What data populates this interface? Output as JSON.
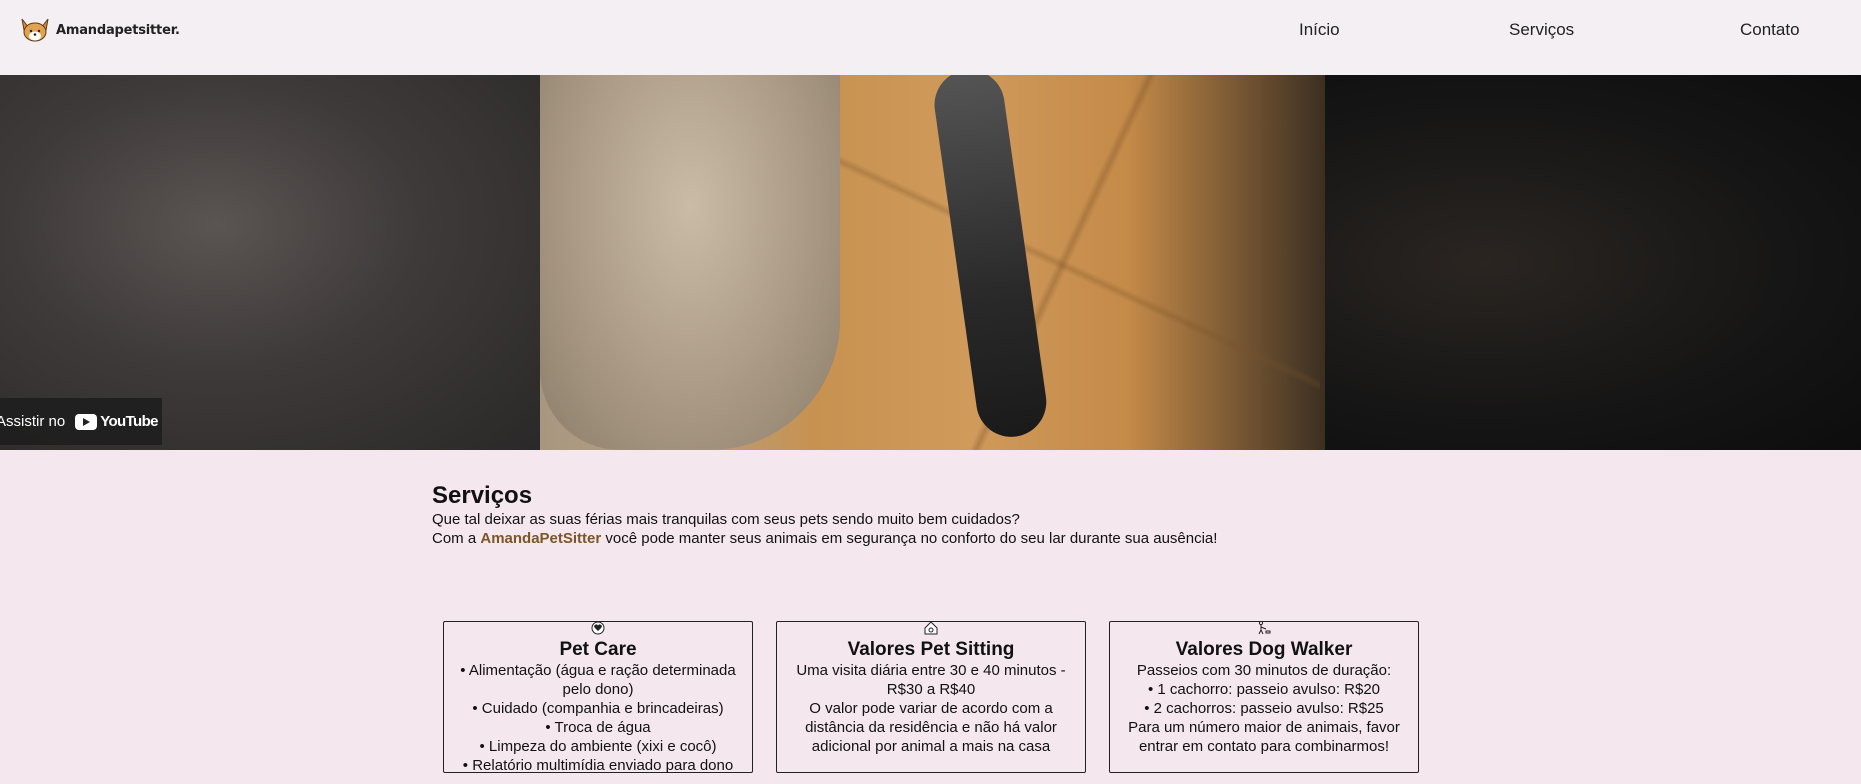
{
  "header": {
    "logo_text": "Amandapetsitter.",
    "logo_icon": "corgi-icon",
    "nav": [
      {
        "label": "Início"
      },
      {
        "label": "Serviços"
      },
      {
        "label": "Contato"
      }
    ]
  },
  "video": {
    "watch_label": "Assistir no",
    "youtube_label": "YouTube"
  },
  "services": {
    "title": "Serviços",
    "intro_line1": "Que tal deixar as suas férias mais tranquilas com seus pets sendo muito bem cuidados?",
    "intro_line2_before": "Com a ",
    "intro_brand": "AmandaPetSitter",
    "intro_line2_after": " você pode manter seus animais em segurança no conforto do seu lar durante sua ausência!"
  },
  "cards": [
    {
      "icon": "pet-heart-icon",
      "title": "Pet Care",
      "lines": [
        "• Alimentação (água e ração determinada",
        "pelo dono)",
        "• Cuidado (companhia e brincadeiras)",
        "• Troca de água",
        "• Limpeza do ambiente (xixi e cocô)",
        "• Relatório multimídia enviado para dono"
      ]
    },
    {
      "icon": "house-pet-icon",
      "title": "Valores Pet Sitting",
      "lines": [
        "Uma visita diária entre 30 e 40 minutos -",
        "R$30 a R$40",
        "O valor pode variar de acordo com a",
        "distância da residência e não há valor",
        "adicional por animal a mais na casa"
      ]
    },
    {
      "icon": "dog-walker-icon",
      "title": "Valores Dog Walker",
      "lines": [
        "Passeios com 30 minutos de duração:",
        "• 1 cachorro: passeio avulso: R$20",
        "• 2 cachorros: passeio avulso: R$25",
        "Para um número maior de animais, favor",
        "entrar em contato para combinarmos!"
      ]
    }
  ]
}
